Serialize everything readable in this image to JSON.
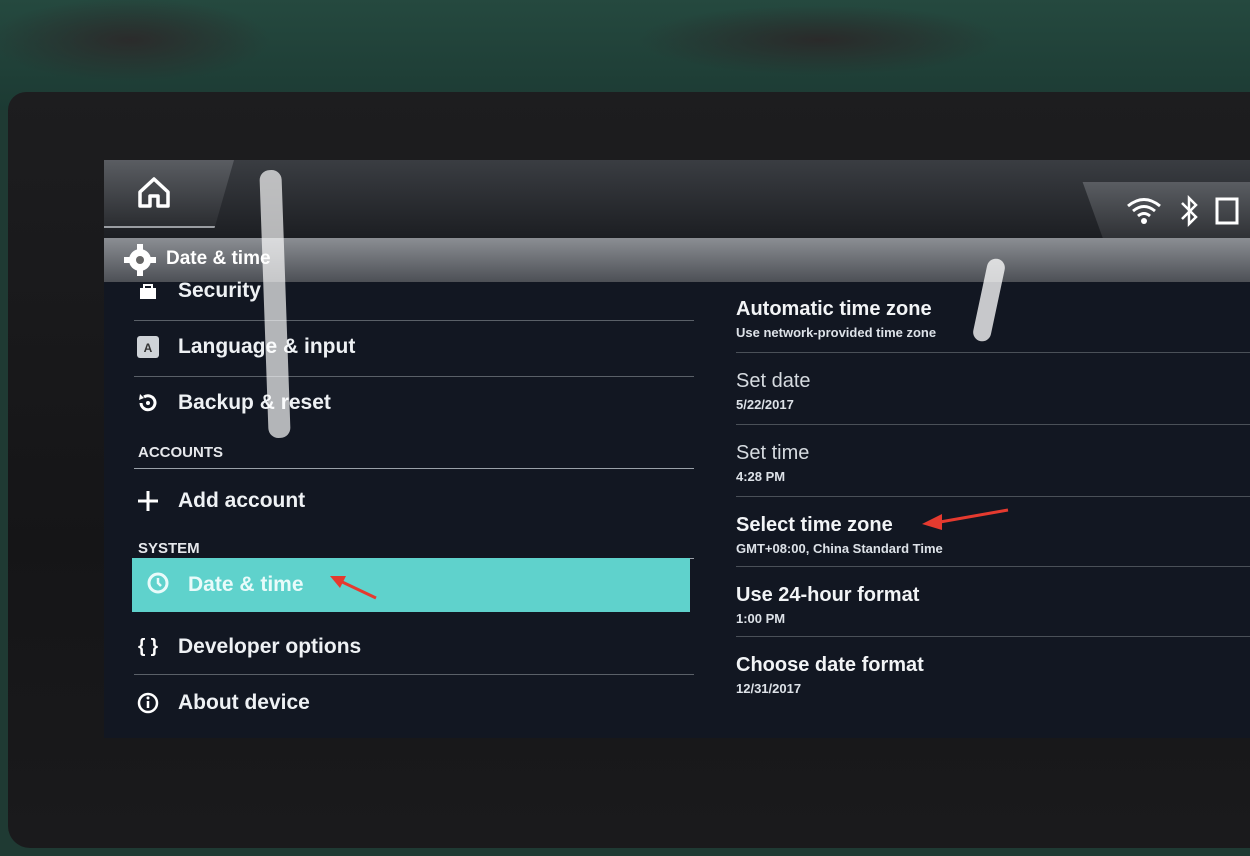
{
  "header": {
    "title": "Date & time"
  },
  "status_icons": [
    "home-icon",
    "wifi-icon",
    "bluetooth-icon",
    "cast-icon"
  ],
  "left_menu": {
    "items_top": [
      {
        "label": "Security",
        "icon": "lock-icon"
      },
      {
        "label": "Language & input",
        "icon": "keyboard-icon"
      },
      {
        "label": "Backup & reset",
        "icon": "restore-icon"
      }
    ],
    "section_accounts": "ACCOUNTS",
    "add_account": "Add account",
    "section_system": "SYSTEM",
    "selected": "Date & time",
    "developer": "Developer options",
    "about": "About device"
  },
  "settings": [
    {
      "title": "Automatic time zone",
      "subtitle": "Use network-provided time zone"
    },
    {
      "title": "Set date",
      "subtitle": "5/22/2017"
    },
    {
      "title": "Set time",
      "subtitle": "4:28 PM"
    },
    {
      "title": "Select time zone",
      "subtitle": "GMT+08:00, China Standard Time"
    },
    {
      "title": "Use 24-hour format",
      "subtitle": "1:00 PM"
    },
    {
      "title": "Choose date format",
      "subtitle": "12/31/2017"
    }
  ],
  "colors": {
    "accent": "#5fd2cc",
    "annotation_arrow": "#e53a2f"
  }
}
